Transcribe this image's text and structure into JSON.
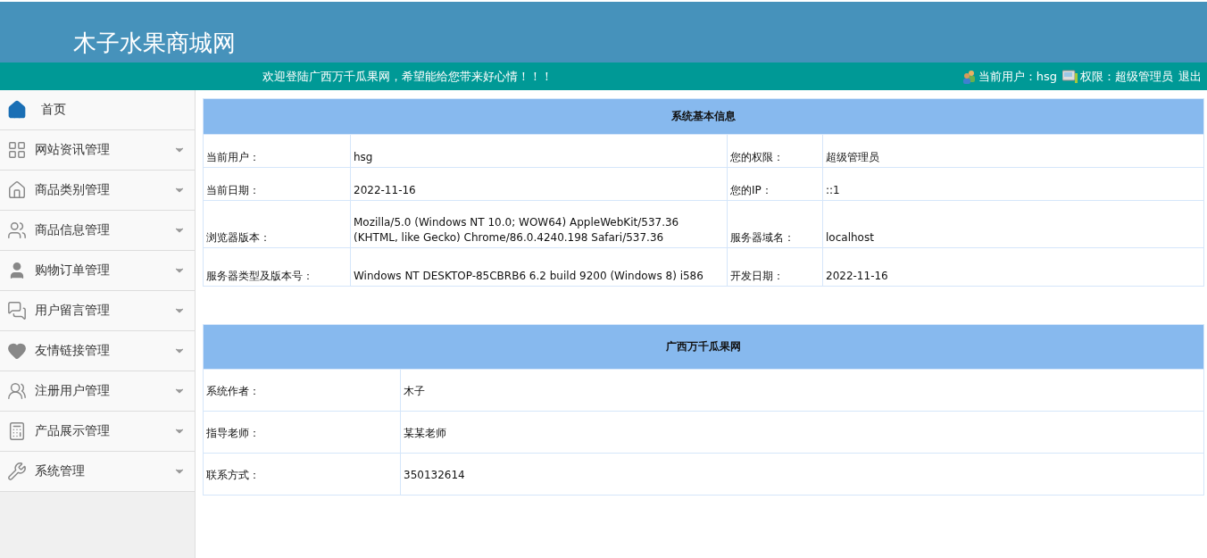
{
  "header": {
    "title": "木子水果商城网"
  },
  "top_bar": {
    "welcome": "欢迎登陆广西万千瓜果网，希望能给您带来好心情！！！",
    "user_label": "当前用户：hsg",
    "role_label": "权限：超级管理员",
    "logout": "退出"
  },
  "sidebar": {
    "items": [
      {
        "label": "首页",
        "kind": "link"
      },
      {
        "label": "网站资讯管理",
        "kind": "menu"
      },
      {
        "label": "商品类别管理",
        "kind": "menu"
      },
      {
        "label": "商品信息管理",
        "kind": "menu"
      },
      {
        "label": "购物订单管理",
        "kind": "menu"
      },
      {
        "label": "用户留言管理",
        "kind": "menu"
      },
      {
        "label": "友情链接管理",
        "kind": "menu"
      },
      {
        "label": "注册用户管理",
        "kind": "menu"
      },
      {
        "label": "产品展示管理",
        "kind": "menu"
      },
      {
        "label": "系统管理",
        "kind": "menu"
      }
    ]
  },
  "system_info": {
    "title": "系统基本信息",
    "rows": [
      {
        "cells": [
          "当前用户：",
          "hsg",
          "您的权限：",
          "超级管理员"
        ]
      },
      {
        "cells": [
          "当前日期：",
          "2022-11-16",
          "您的IP：",
          "::1"
        ]
      },
      {
        "cells": [
          "浏览器版本：",
          "Mozilla/5.0 (Windows NT 10.0; WOW64) AppleWebKit/537.36 (KHTML, like Gecko) Chrome/86.0.4240.198 Safari/537.36",
          "服务器域名：",
          "localhost"
        ]
      },
      {
        "cells": [
          "服务器类型及版本号：",
          "Windows NT DESKTOP-85CBRB6 6.2 build 9200 (Windows 8) i586",
          "开发日期：",
          "2022-11-16"
        ]
      }
    ]
  },
  "site_info": {
    "title": "广西万千瓜果网",
    "rows": [
      {
        "cells": [
          "系统作者：",
          "木子"
        ]
      },
      {
        "cells": [
          "指导老师：",
          "某某老师"
        ]
      },
      {
        "cells": [
          "联系方式：",
          "350132614"
        ]
      }
    ]
  }
}
